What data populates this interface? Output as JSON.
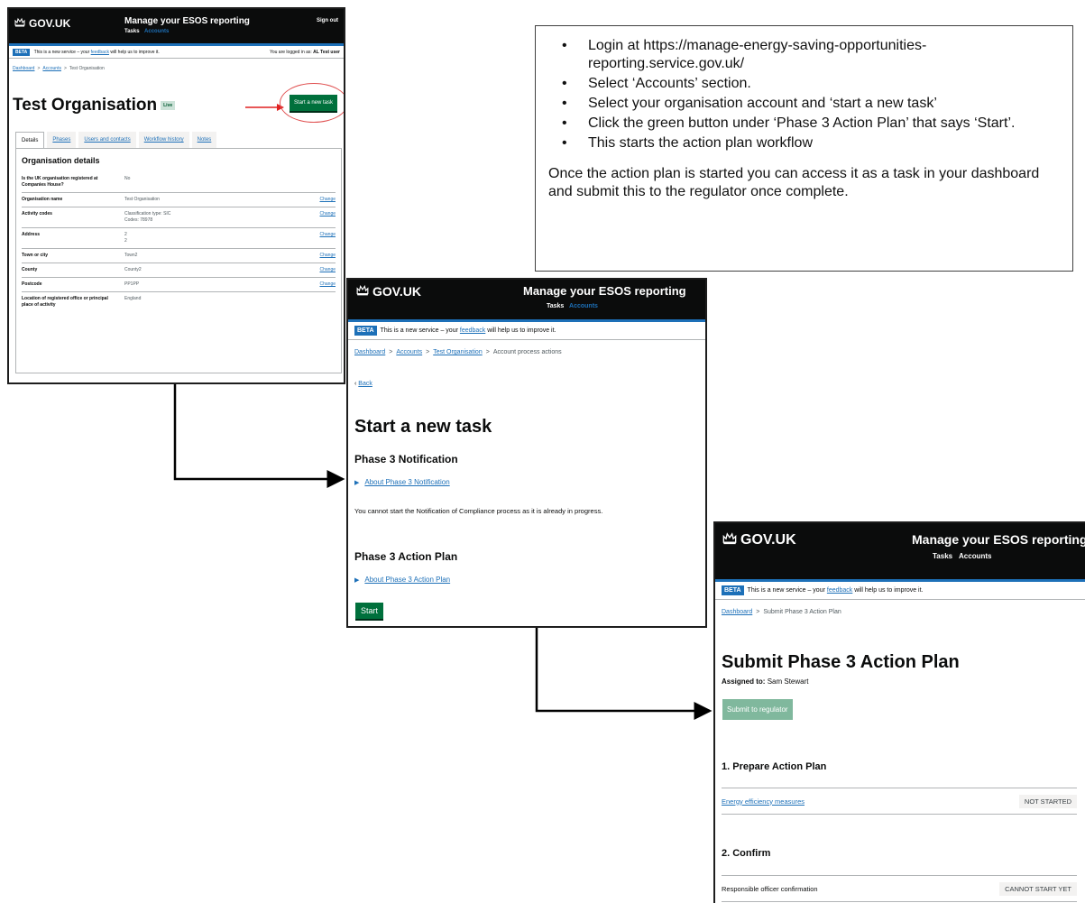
{
  "instructions": {
    "bullets": [
      "Login at https://manage-energy-saving-opportunities-reporting.service.gov.uk/",
      "Select ‘Accounts’ section.",
      "Select your organisation account and ‘start a new task’",
      "Click the green button under ‘Phase 3 Action Plan’ that says ‘Start’.",
      "This starts the action plan workflow"
    ],
    "summary": "Once the action plan is started you can access it as a task in your dashboard and submit this to the regulator once complete."
  },
  "common": {
    "gov_logo": "GOV.UK",
    "service_name": "Manage your ESOS reporting",
    "nav_tasks": "Tasks",
    "nav_accounts": "Accounts",
    "beta_tag": "BETA",
    "beta_text_pre": "This is a new service – your",
    "beta_link": "feedback",
    "beta_text_post": "will help us to improve it.",
    "colors": {
      "header": "#0b0c0c",
      "link": "#1d70b8",
      "button": "#00703c",
      "highlight_ring": "#e05050"
    }
  },
  "screen1": {
    "sign_out": "Sign out",
    "logged_in": "You are logged in as:",
    "logged_in_user": "AL Test user",
    "breadcrumbs": [
      "Dashboard",
      "Accounts",
      "Test Organisation"
    ],
    "title": "Test Organisation",
    "status_tag": "Live",
    "new_task_button": "Start a new task",
    "tabs": [
      "Details",
      "Phases",
      "Users and contacts",
      "Workflow history",
      "Notes"
    ],
    "panel_title": "Organisation details",
    "change_label": "Change",
    "rows": [
      {
        "key": "Is the UK organisation registered at Companies House?",
        "value": "No",
        "change": false
      },
      {
        "key": "Organisation name",
        "value": "Test Organisation",
        "change": true
      },
      {
        "key": "Activity codes",
        "value": "Classification type: SIC",
        "value2": "Codes: 78978",
        "change": true
      },
      {
        "key": "Address",
        "value": "2",
        "value2": "2",
        "change": true
      },
      {
        "key": "Town or city",
        "value": "Town2",
        "change": true
      },
      {
        "key": "County",
        "value": "County2",
        "change": true
      },
      {
        "key": "Postcode",
        "value": "PP1PP",
        "change": true
      },
      {
        "key": "Location of registered office or principal place of activity",
        "value": "England",
        "change": false
      }
    ]
  },
  "screen2": {
    "breadcrumbs": [
      "Dashboard",
      "Accounts",
      "Test Organisation",
      "Account process actions"
    ],
    "back": "Back",
    "title": "Start a new task",
    "notification_heading": "Phase 3 Notification",
    "notification_details": "About Phase 3 Notification",
    "notification_note": "You cannot start the Notification of Compliance process as it is already in progress.",
    "action_plan_heading": "Phase 3 Action Plan",
    "action_plan_details": "About Phase 3 Action Plan",
    "start_button": "Start"
  },
  "screen3": {
    "breadcrumbs": [
      "Dashboard",
      "Submit Phase 3 Action Plan"
    ],
    "title": "Submit Phase 3 Action Plan",
    "assigned_label": "Assigned to:",
    "assigned_name": "Sam Stewart",
    "submit_button": "Submit to regulator",
    "section1": "1. Prepare Action Plan",
    "task1": "Energy efficiency measures",
    "task1_status": "NOT STARTED",
    "section2": "2. Confirm",
    "task2": "Responsible officer confirmation",
    "task2_status": "CANNOT START YET"
  }
}
